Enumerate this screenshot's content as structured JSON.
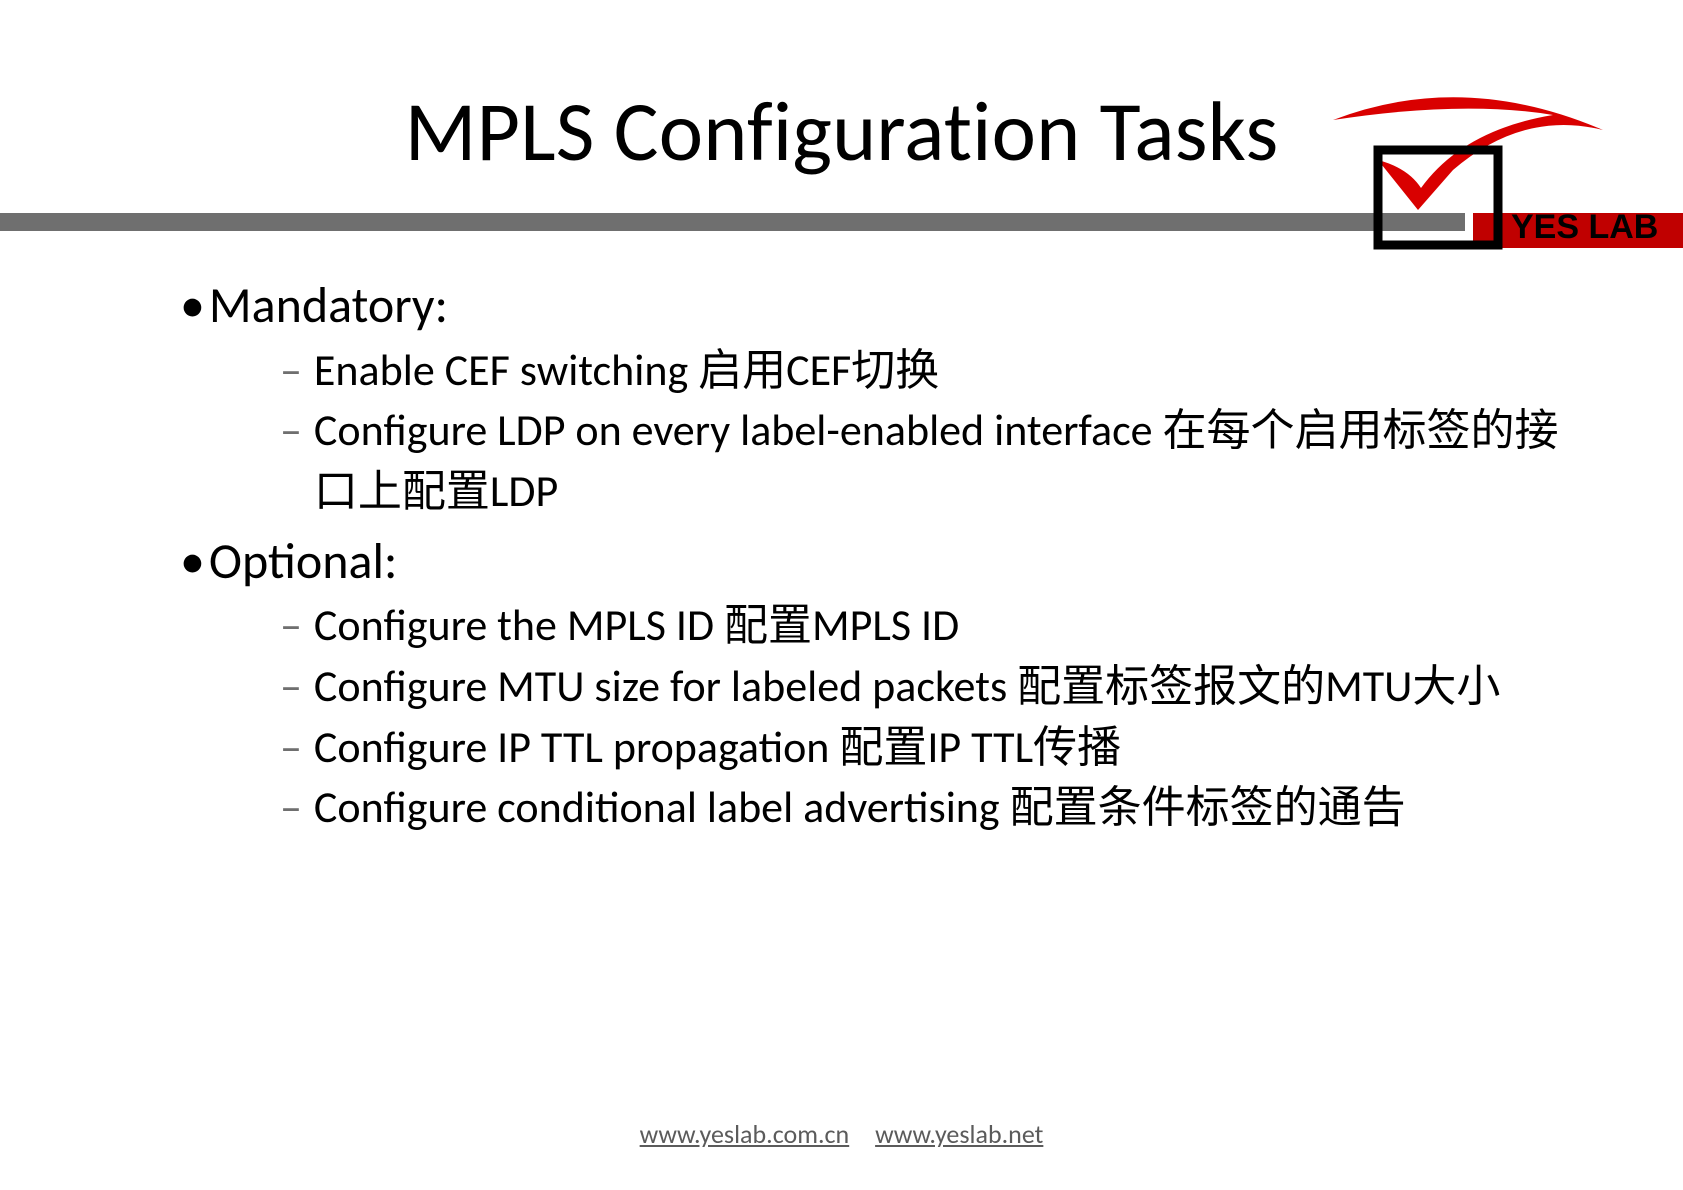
{
  "title": "MPLS Configuration Tasks",
  "logo_text": "YES LAB",
  "sections": [
    {
      "heading": "Mandatory:",
      "items": [
        "Enable CEF switching  启用CEF切换",
        "Configure LDP on every label-enabled interface  在每个启用标签的接口上配置LDP"
      ]
    },
    {
      "heading": "Optional:",
      "items": [
        "Configure the MPLS ID   配置MPLS ID",
        "Configure MTU size for labeled packets   配置标签报文的MTU大小",
        "Configure IP TTL propagation   配置IP TTL传播",
        "Configure conditional label advertising   配置条件标签的通告"
      ]
    }
  ],
  "footer_links": [
    "www.yeslab.com.cn",
    "www.yeslab.net"
  ]
}
